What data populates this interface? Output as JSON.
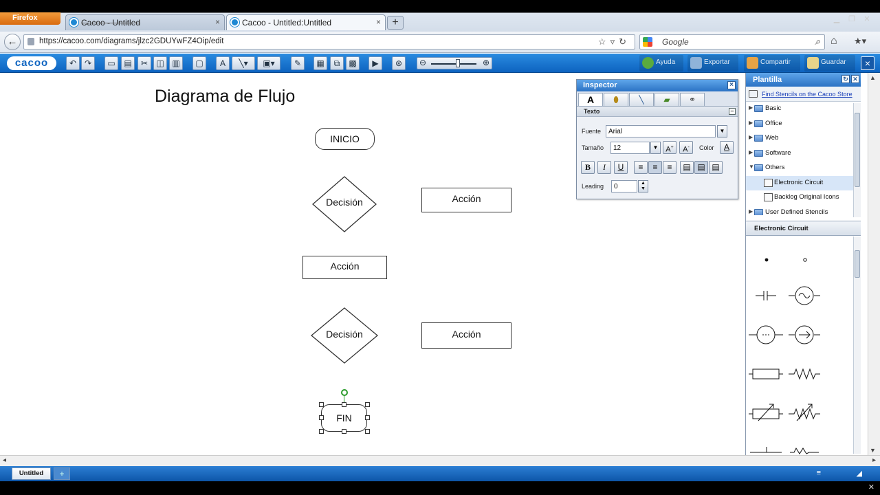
{
  "browser": {
    "menu_button": "Firefox",
    "tabs": [
      {
        "title": "Cacoo - Untitled",
        "close": "×"
      },
      {
        "title": "Cacoo - Untitled:Untitled",
        "close": "×"
      }
    ],
    "new_tab": "+",
    "url": "https://cacoo.com/diagrams/jlzc2GDUYwFZ4Oip/edit",
    "search_placeholder": "Google"
  },
  "toolbar": {
    "logo": "cacoo",
    "help": "Ayuda",
    "export": "Exportar",
    "share": "Compartir",
    "save": "Guardar",
    "close": "×"
  },
  "canvas": {
    "title": "Diagrama de Flujo",
    "start": "INICIO",
    "decision1": "Decisión",
    "action1": "Acción",
    "action2": "Acción",
    "decision2": "Decisión",
    "action3": "Acción",
    "end": "FIN"
  },
  "inspector": {
    "title": "Inspector",
    "close": "×",
    "tab_text": "A",
    "section": "Texto",
    "font_label": "Fuente",
    "font_value": "Arial",
    "size_label": "Tamaño",
    "size_value": "12",
    "color_label": "Color",
    "bold": "B",
    "italic": "I",
    "underline": "U",
    "leading_label": "Leading",
    "leading_value": "0"
  },
  "plantilla": {
    "title": "Plantilla",
    "find_link": "Find Stencils on the Cacoo Store",
    "tree": [
      {
        "label": "Basic",
        "expanded": false
      },
      {
        "label": "Office",
        "expanded": false
      },
      {
        "label": "Web",
        "expanded": false
      },
      {
        "label": "Software",
        "expanded": false
      },
      {
        "label": "Others",
        "expanded": true
      },
      {
        "label": "Electronic Circuit",
        "sub": true,
        "selected": true
      },
      {
        "label": "Backlog Original Icons",
        "sub": true
      },
      {
        "label": "User Defined Stencils",
        "expanded": false
      }
    ],
    "stencil_title": "Electronic Circuit"
  },
  "sheets": {
    "active": "Untitled"
  }
}
